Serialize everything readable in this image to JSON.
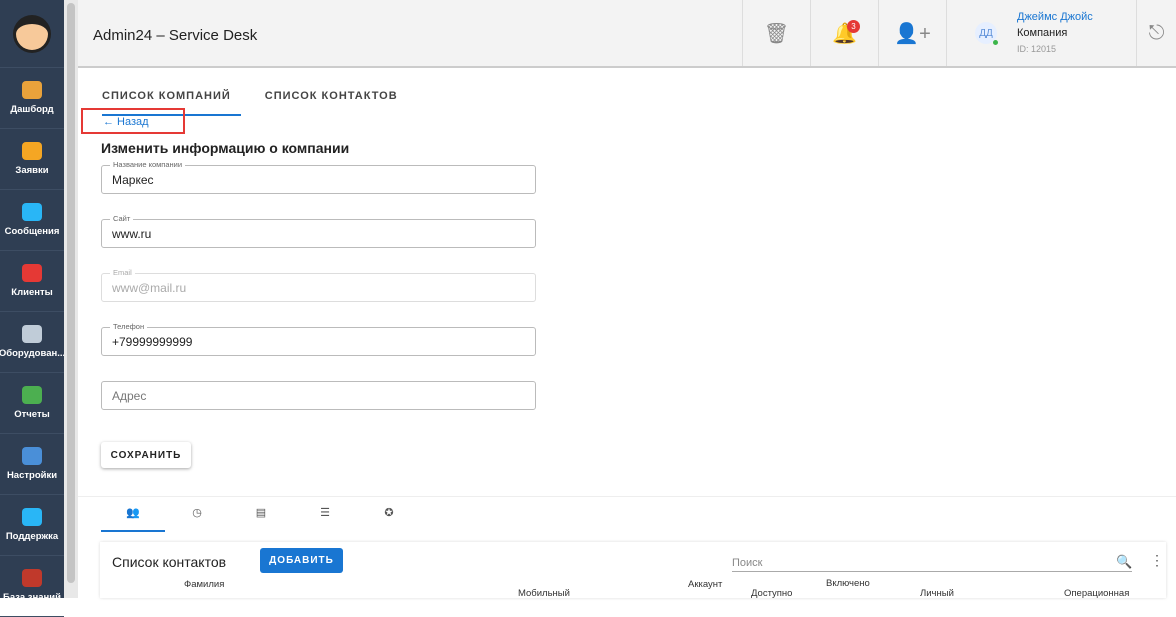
{
  "sidebar": {
    "items": [
      {
        "label": "Дашборд",
        "color": "#e9a23b"
      },
      {
        "label": "Заявки",
        "color": "#f5a623"
      },
      {
        "label": "Сообщения",
        "color": "#29b6f6"
      },
      {
        "label": "Клиенты",
        "color": "#e53935"
      },
      {
        "label": "Оборудован...",
        "color": "#c0ccd8"
      },
      {
        "label": "Отчеты",
        "color": "#4caf50"
      },
      {
        "label": "Настройки",
        "color": "#4a8fd8"
      },
      {
        "label": "Поддержка",
        "color": "#29b6f6"
      },
      {
        "label": "База знаний",
        "color": "#c0392b"
      }
    ]
  },
  "header": {
    "title": "Admin24 – Service Desk",
    "notifications": "3",
    "user": {
      "initials": "ДД",
      "name": "Джеймс Джойс",
      "role": "Компания",
      "id": "ID: 12015"
    }
  },
  "tabs": [
    "СПИСОК КОМПАНИЙ",
    "СПИСОК КОНТАКТОВ"
  ],
  "back": "← Назад",
  "form": {
    "title": "Изменить информацию о компании",
    "fields": [
      {
        "label": "Название компании",
        "value": "Маркес"
      },
      {
        "label": "Сайт",
        "value": "www.ru"
      },
      {
        "label": "Email",
        "value": "www@mail.ru"
      },
      {
        "label": "Телефон",
        "value": "+79999999999"
      },
      {
        "placeholder": "Адрес"
      }
    ],
    "save": "СОХРАНИТЬ"
  },
  "inner_tabs": [
    "👥",
    "◷",
    "▤",
    "☰",
    "✪"
  ],
  "contacts": {
    "title": "Список контактов",
    "add": "ДОБАВИТЬ",
    "search_placeholder": "Поиск",
    "columns": [
      "Фамилия",
      "Мобильный",
      "Аккаунт",
      "Доступно",
      "Включено",
      "Личный",
      "Операционная"
    ]
  }
}
